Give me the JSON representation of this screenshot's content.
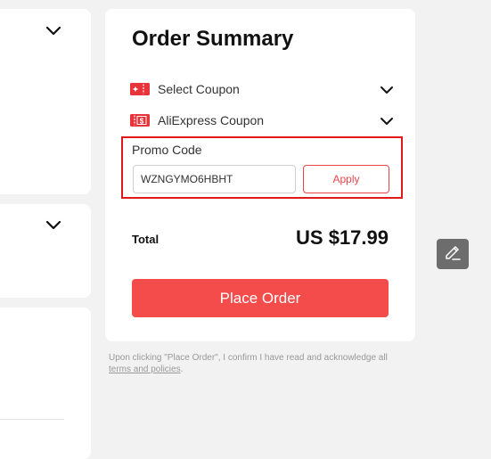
{
  "summary": {
    "title": "Order Summary",
    "select_coupon": {
      "label": "Select Coupon",
      "icon": "coupon-ticket-icon"
    },
    "aliexpress_coupon": {
      "label": "AliExpress Coupon",
      "icon": "dollar-ticket-icon"
    },
    "promo": {
      "label": "Promo Code",
      "value": "WZNGYMO6HBHT",
      "apply_label": "Apply"
    },
    "total_label": "Total",
    "total_value": "US $17.99",
    "place_order_label": "Place Order"
  },
  "disclaimer": {
    "text": "Upon clicking \"Place Order\", I confirm I have read and acknowledge all",
    "link": "terms and policies",
    "suffix": "."
  },
  "colors": {
    "accent": "#f44b4b",
    "highlight": "#e01a1a",
    "background": "#f2f2f2"
  },
  "icons": {
    "edit": "pencil-edit-icon",
    "expand": "chevron-down-icon"
  }
}
